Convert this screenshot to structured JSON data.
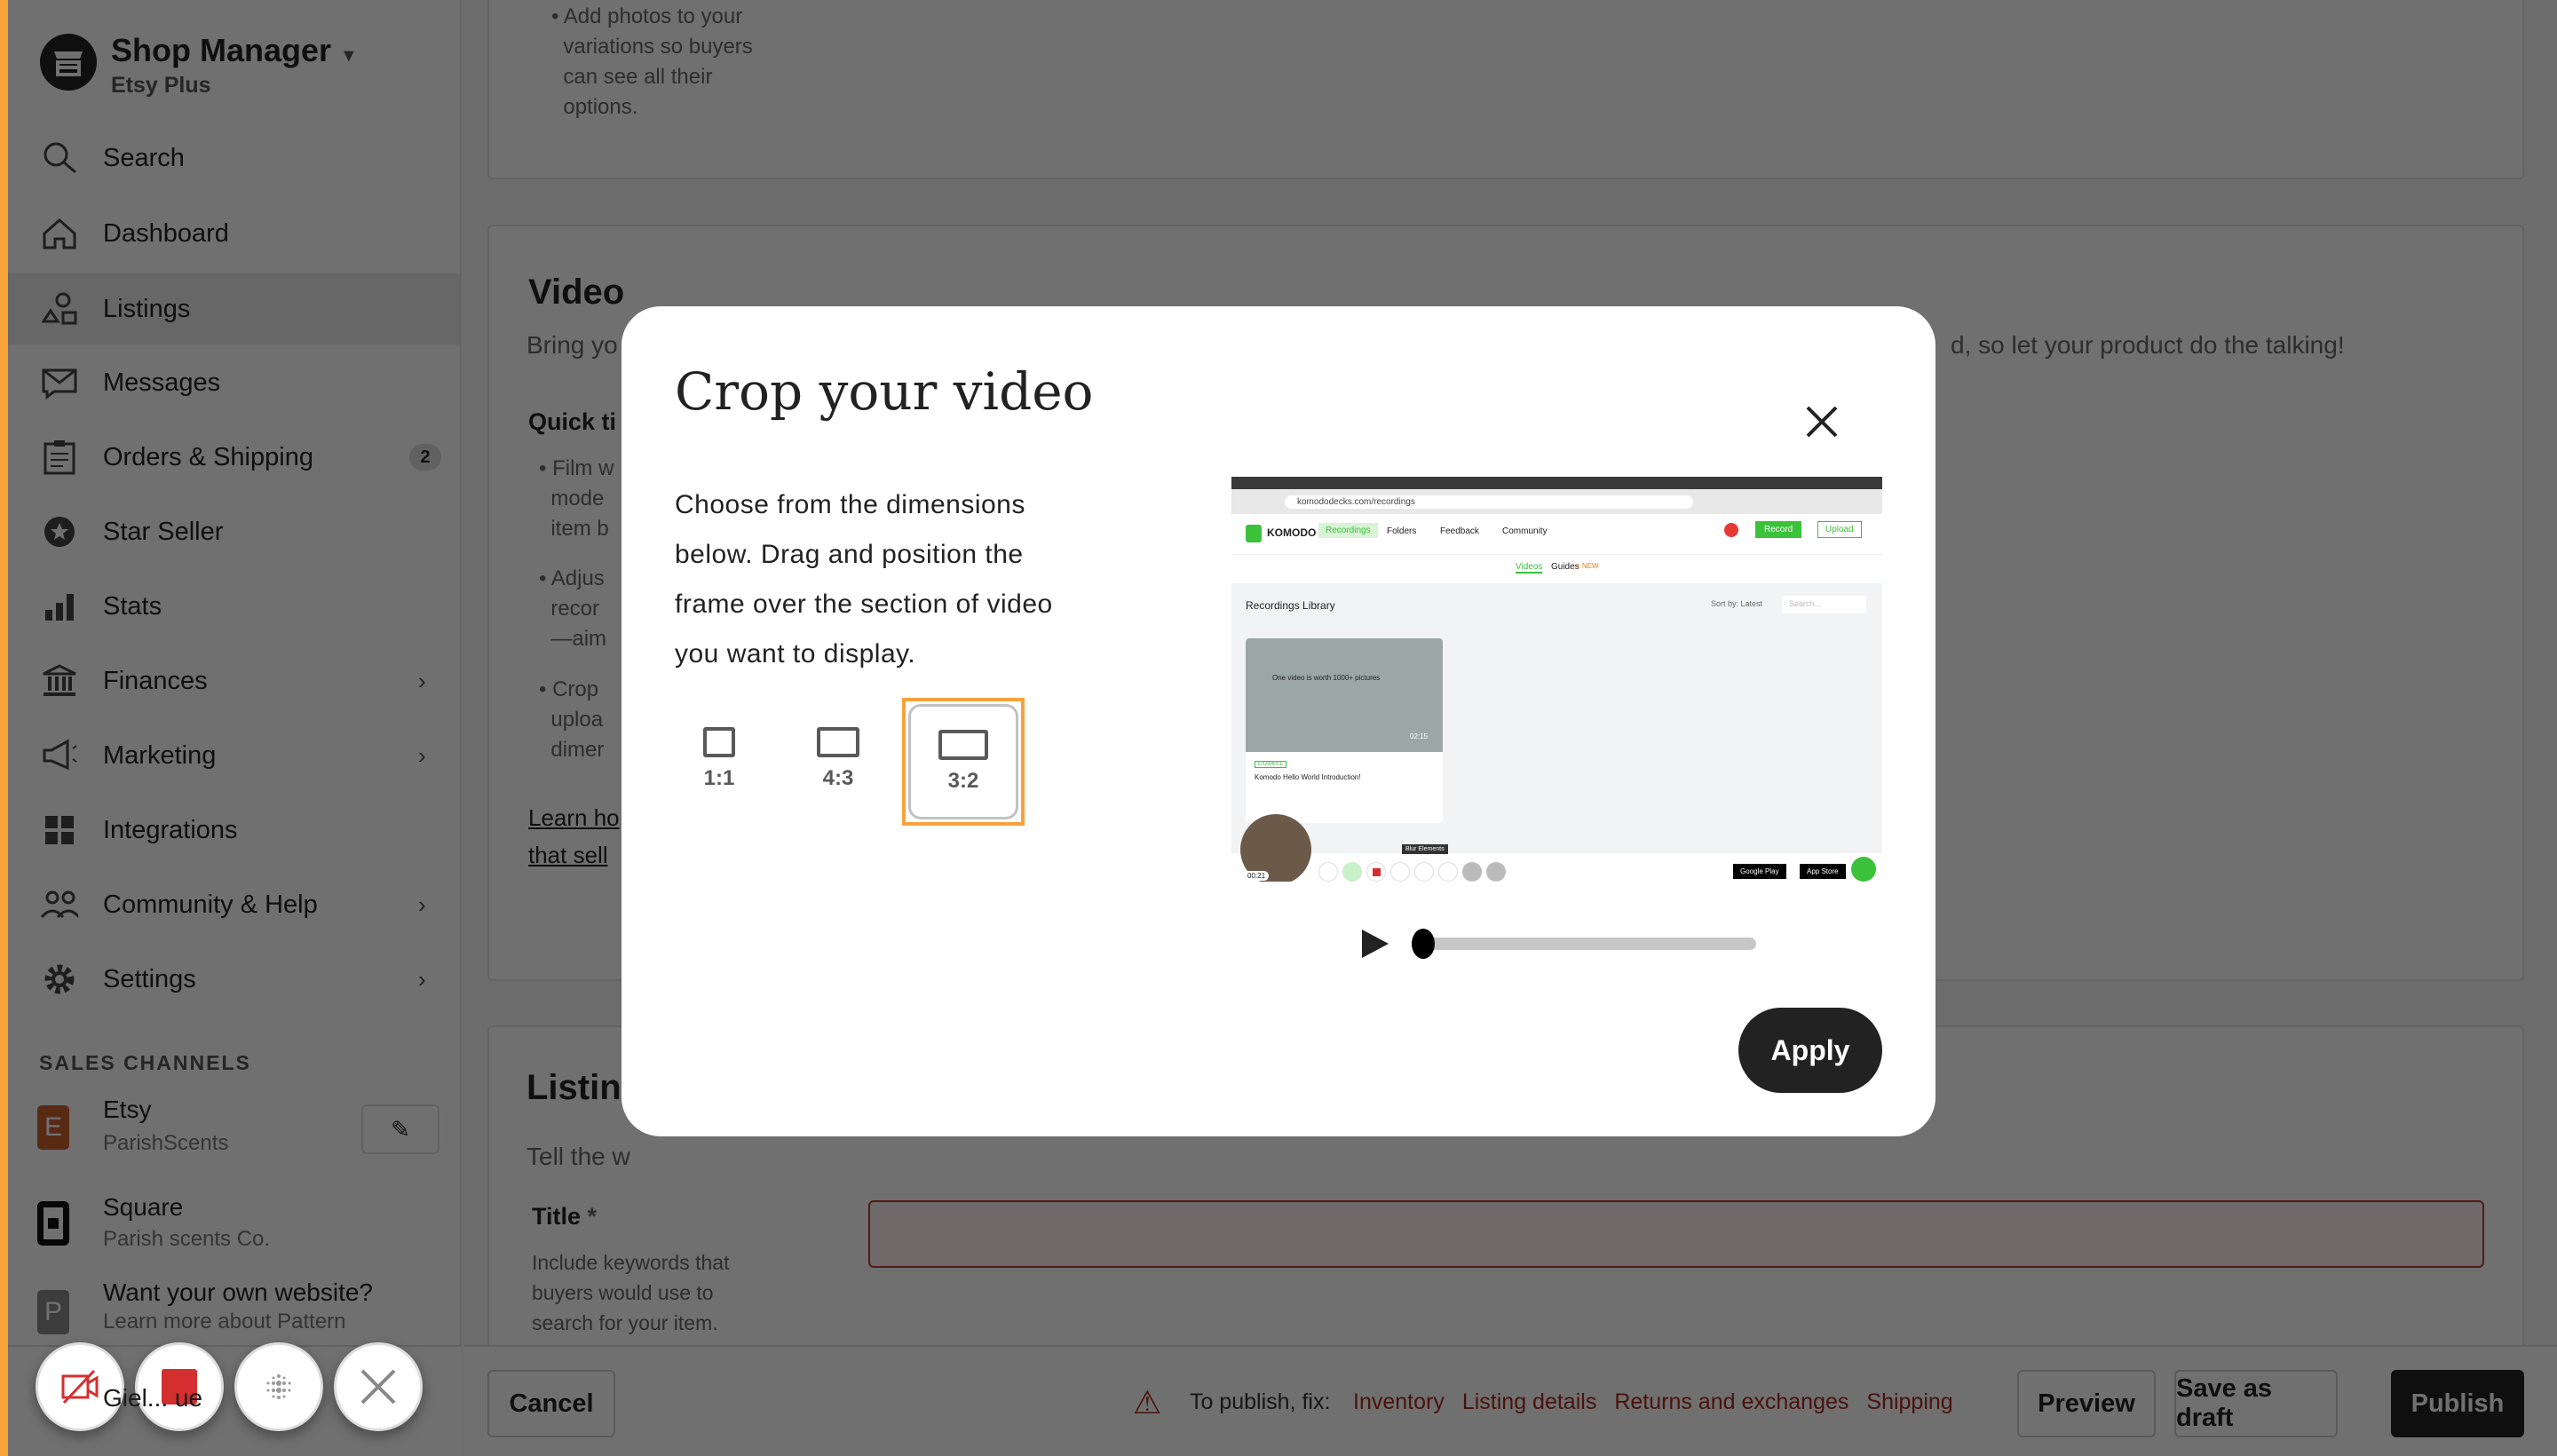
{
  "sidebar": {
    "shop_title": "Shop Manager",
    "shop_plan": "Etsy Plus",
    "items": [
      {
        "label": "Search",
        "icon": "search-icon"
      },
      {
        "label": "Dashboard",
        "icon": "home-icon"
      },
      {
        "label": "Listings",
        "icon": "shapes-icon",
        "active": true
      },
      {
        "label": "Messages",
        "icon": "envelope-icon"
      },
      {
        "label": "Orders & Shipping",
        "icon": "clipboard-icon",
        "badge": "2"
      },
      {
        "label": "Star Seller",
        "icon": "star-badge-icon"
      },
      {
        "label": "Stats",
        "icon": "bar-chart-icon"
      },
      {
        "label": "Finances",
        "icon": "bank-icon",
        "chevron": true
      },
      {
        "label": "Marketing",
        "icon": "megaphone-icon",
        "chevron": true
      },
      {
        "label": "Integrations",
        "icon": "grid-icon"
      },
      {
        "label": "Community & Help",
        "icon": "people-icon",
        "chevron": true
      },
      {
        "label": "Settings",
        "icon": "gear-icon",
        "chevron": true
      }
    ],
    "sales_channels_heading": "SALES CHANNELS",
    "channels": [
      {
        "initial": "E",
        "name": "Etsy",
        "sub": "ParishScents",
        "color": "#d2691e"
      },
      {
        "name": "Square",
        "sub": "Parish scents Co."
      },
      {
        "initial": "P",
        "name": "Want your own website?",
        "sub": "Learn more about Pattern"
      }
    ],
    "footer_user": "Giel... ue"
  },
  "main": {
    "variations_tip": [
      "Add photos to your",
      "variations so buyers",
      "can see all their",
      "options."
    ],
    "video_title": "Video",
    "video_desc_start": "Bring yo",
    "video_desc_end": "d, so let your product do the talking!",
    "quick_tips": "Quick ti",
    "tips": [
      [
        "Film w",
        "mode",
        "item b"
      ],
      [
        "Adjus",
        "recor",
        "—aim"
      ],
      [
        "Crop",
        "uploa",
        "dimer"
      ]
    ],
    "learn_link": [
      "Learn ho",
      "that sell"
    ],
    "listing_title": "Listin",
    "listing_desc": "Tell the w",
    "title_label": "Title",
    "title_required": "*",
    "title_help": [
      "Include keywords that",
      "buyers would use to",
      "search for your item."
    ]
  },
  "bottom_bar": {
    "cancel": "Cancel",
    "publish_prefix": "To publish, fix:",
    "fix_links": [
      "Inventory",
      "Listing details",
      "Returns and exchanges",
      "Shipping"
    ],
    "preview": "Preview",
    "save_draft": "Save as draft",
    "publish": "Publish"
  },
  "modal": {
    "title": "Crop your video",
    "description": [
      "Choose from the dimensions",
      "below. Drag and position the",
      "frame over the section of video",
      "you want to display."
    ],
    "ratios": [
      {
        "label": "1:1"
      },
      {
        "label": "4:3"
      },
      {
        "label": "3:2",
        "selected": true
      }
    ],
    "apply": "Apply",
    "playback_progress": 0,
    "preview": {
      "url": "komododecks.com/recordings",
      "brand": "KOMODO",
      "nav": [
        "Recordings",
        "Folders",
        "Feedback",
        "Community"
      ],
      "record": "Record",
      "upload": "Upload",
      "tabs": [
        "Videos",
        "Guides"
      ],
      "new_badge": "+ NEW",
      "library_title": "Recordings Library",
      "sort": "Sort by: Latest",
      "search_placeholder": "Search...",
      "card_tag": "EXAMPLE",
      "card_title": "Komodo Hello World Introduction!",
      "card_thumb_text": "One video is worth 1000+ pictures",
      "card_duration": "02:15",
      "timer": "00:21",
      "tooltip": "Blur Elements",
      "google_play": "Google Play",
      "app_store": "App Store"
    }
  },
  "colors": {
    "accent": "#f7a23b",
    "selected_outline": "#f7a23b",
    "error": "#a52a1e",
    "komodo_green": "#3cc13b"
  }
}
